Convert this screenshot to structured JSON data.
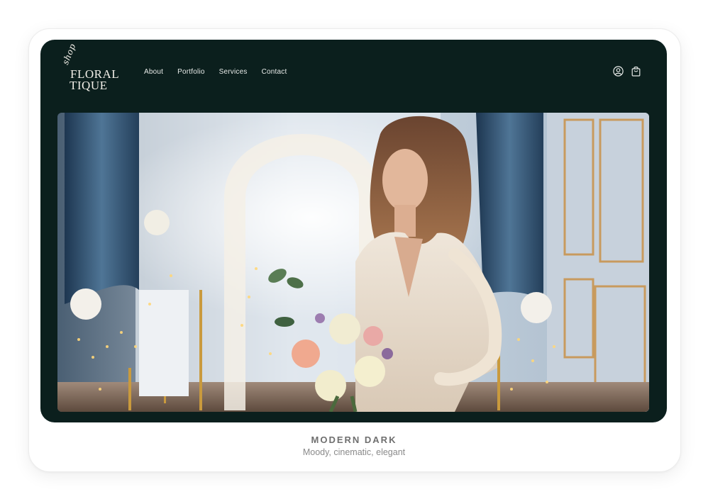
{
  "brand": {
    "logo_small": "shop",
    "logo_line1": "FLORAL",
    "logo_line2": "TIQUE"
  },
  "nav": {
    "items": [
      "About",
      "Portfolio",
      "Services",
      "Contact"
    ]
  },
  "header_icons": [
    "account-icon",
    "shopping-bag-icon"
  ],
  "hero": {
    "image": "bride-with-bouquet-photo"
  },
  "caption": {
    "title": "MODERN DARK",
    "subtitle": "Moody, cinematic, elegant"
  },
  "colors": {
    "site_background": "#0b1f1d",
    "nav_text": "#e8ebe9",
    "caption_title": "#6f6f6f",
    "caption_subtitle": "#8a8a8a"
  }
}
